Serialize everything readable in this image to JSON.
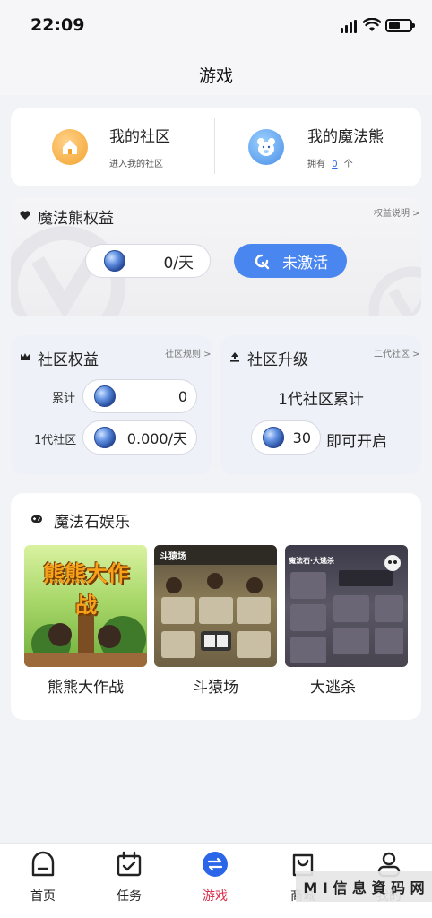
{
  "status": {
    "time": "22:09"
  },
  "page_title": "游戏",
  "top_card": {
    "community": {
      "title": "我的社区",
      "subtitle": "进入我的社区"
    },
    "bears": {
      "title": "我的魔法熊",
      "own_prefix": "拥有",
      "count": "0",
      "unit": "个"
    }
  },
  "bear_rights": {
    "title": "魔法熊权益",
    "link": "权益说明 >",
    "rate": "0/天",
    "activate_label": "未激活"
  },
  "community_rights": {
    "title": "社区权益",
    "link": "社区规则 >",
    "rows": [
      {
        "label": "累计",
        "value": "0"
      },
      {
        "label": "1代社区",
        "value": "0.000/天"
      }
    ]
  },
  "community_upgrade": {
    "title": "社区升级",
    "link": "二代社区 >",
    "desc": "1代社区累计",
    "amount": "30",
    "suffix": "即可开启"
  },
  "entertainment": {
    "title": "魔法石娱乐",
    "games": [
      {
        "name": "熊熊大作战",
        "art_title": "熊熊大作战"
      },
      {
        "name": "斗猿场",
        "art_title": "斗猿场"
      },
      {
        "name": "大逃杀",
        "art_title": "魔法石·大逃杀"
      }
    ]
  },
  "tabs": [
    {
      "label": "首页",
      "active": false
    },
    {
      "label": "任务",
      "active": false
    },
    {
      "label": "游戏",
      "active": true
    },
    {
      "label": "商城",
      "active": false
    },
    {
      "label": "我的",
      "active": false
    }
  ],
  "watermark": "M I 信 息 資 码 网",
  "colors": {
    "accent": "#2b66e8",
    "active_tab": "#d9304c",
    "activate_btn": "#4a86ef"
  }
}
